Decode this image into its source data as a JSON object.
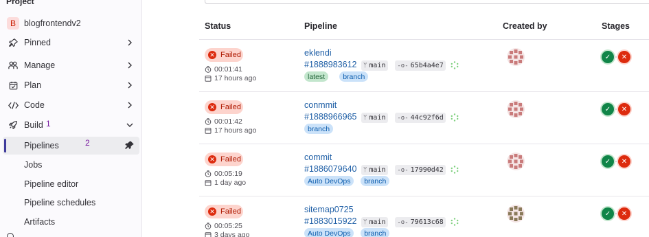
{
  "sidebar": {
    "section_title": "Project",
    "project": {
      "initial": "B",
      "name": "blogfrontendv2"
    },
    "items": [
      {
        "label": "Pinned",
        "icon": "pin-icon",
        "chevron": "right"
      },
      {
        "label": "Manage",
        "icon": "users-icon",
        "chevron": "right"
      },
      {
        "label": "Plan",
        "icon": "calendar-icon",
        "chevron": "right"
      },
      {
        "label": "Code",
        "icon": "code-icon",
        "chevron": "right"
      },
      {
        "label": "Build",
        "icon": "rocket-icon",
        "chevron": "down",
        "annotation": "1"
      }
    ],
    "build_subitems": [
      {
        "label": "Pipelines",
        "active": true,
        "annotation": "2",
        "icon": "pin-icon"
      },
      {
        "label": "Jobs"
      },
      {
        "label": "Pipeline editor"
      },
      {
        "label": "Pipeline schedules"
      },
      {
        "label": "Artifacts"
      }
    ]
  },
  "table": {
    "headers": {
      "status": "Status",
      "pipeline": "Pipeline",
      "created_by": "Created by",
      "stages": "Stages"
    },
    "rows": [
      {
        "status": "Failed",
        "duration": "00:01:41",
        "finished": "17 hours ago",
        "name": "eklendi",
        "id": "#1888983612",
        "ref": "main",
        "sha": "65b4a4e7",
        "tags": [
          {
            "label": "latest",
            "kind": "green"
          },
          {
            "label": "branch",
            "kind": "blue"
          }
        ],
        "avatar_color": "#c97b7b"
      },
      {
        "status": "Failed",
        "duration": "00:01:42",
        "finished": "17 hours ago",
        "name": "conmmit",
        "id": "#1888966965",
        "ref": "main",
        "sha": "44c92f6d",
        "tags": [
          {
            "label": "branch",
            "kind": "blue"
          }
        ],
        "avatar_color": "#c97b7b"
      },
      {
        "status": "Failed",
        "duration": "00:05:19",
        "finished": "1 day ago",
        "name": "commit",
        "id": "#1886079640",
        "ref": "main",
        "sha": "17990d42",
        "tags": [
          {
            "label": "Auto DevOps",
            "kind": "blue"
          },
          {
            "label": "branch",
            "kind": "blue"
          }
        ],
        "avatar_color": "#c97b7b"
      },
      {
        "status": "Failed",
        "duration": "00:05:25",
        "finished": "3 days ago",
        "name": "sitemap0725",
        "id": "#1883015922",
        "ref": "main",
        "sha": "79613c68",
        "tags": [
          {
            "label": "Auto DevOps",
            "kind": "blue"
          },
          {
            "label": "branch",
            "kind": "blue"
          }
        ],
        "avatar_color": "#8a7a5a"
      }
    ]
  },
  "colors": {
    "failed": "#dd2b0e",
    "success": "#108548",
    "link": "#1f5fa6"
  }
}
